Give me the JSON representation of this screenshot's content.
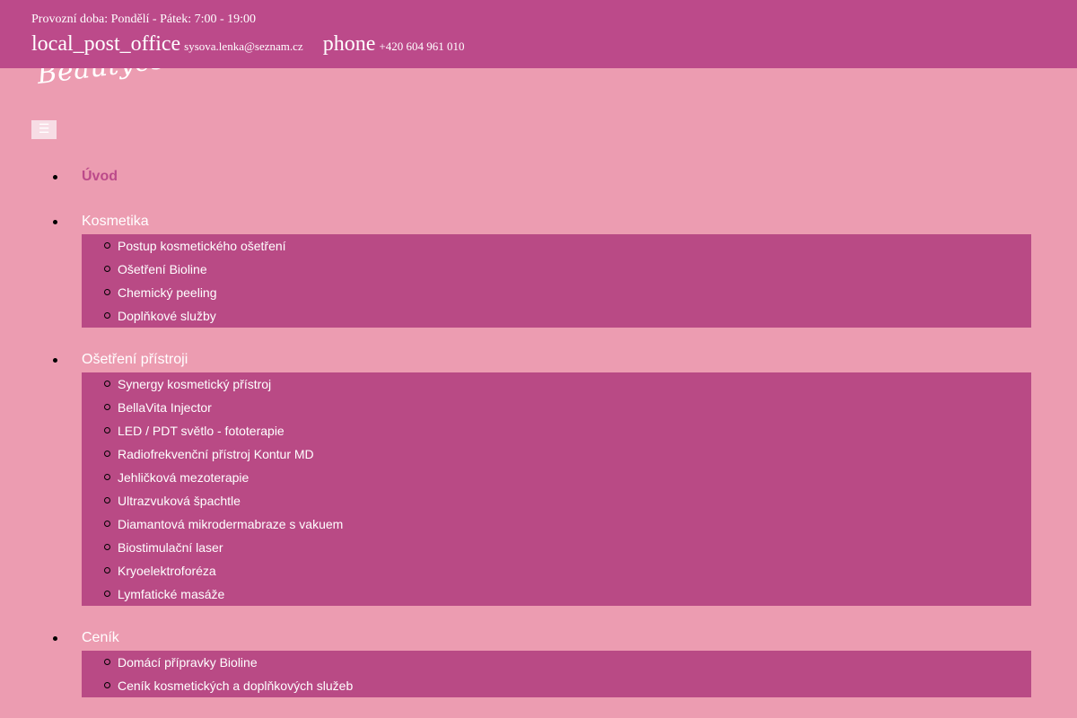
{
  "header": {
    "hours": "Provozní doba: Pondělí - Pátek: 7:00 - 19:00",
    "email_icon": "local_post_office",
    "email": "sysova.lenka@seznam.cz",
    "phone_icon": "phone",
    "phone": "+420 604 961 010"
  },
  "logo": {
    "text": "Beautyester"
  },
  "menu_toggle": {
    "label": "☰"
  },
  "nav": {
    "uvod": "Úvod",
    "kosmetika": {
      "label": "Kosmetika",
      "items": [
        "Postup kosmetického ošetření",
        "Ošetření Bioline",
        "Chemický peeling",
        "Doplňkové služby"
      ]
    },
    "pristroje": {
      "label": "Ošetření přístroji",
      "items": [
        "Synergy kosmetický přístroj",
        "BellaVita Injector",
        "LED / PDT světlo - fototerapie",
        "Radiofrekvenční přístroj Kontur MD",
        "Jehličková mezoterapie",
        "Ultrazvuková špachtle",
        "Diamantová mikrodermabraze s vakuem",
        "Biostimulační laser",
        "Kryoelektroforéza",
        "Lymfatické masáže"
      ]
    },
    "cenik": {
      "label": "Ceník",
      "items": [
        "Domácí přípravky Bioline",
        "Ceník kosmetických a doplňkových služeb"
      ]
    }
  },
  "colors": {
    "background": "#ec9cb1",
    "header": "#bc4a8a",
    "submenu": "#b94a85",
    "active_link": "#bc4a8a"
  }
}
